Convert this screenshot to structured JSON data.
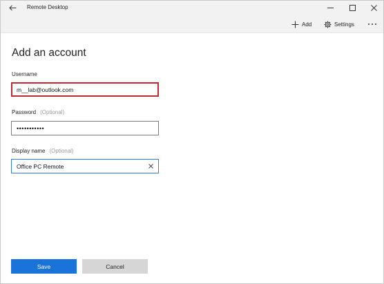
{
  "window": {
    "title": "Remote Desktop"
  },
  "commandbar": {
    "add_label": "Add",
    "settings_label": "Settings"
  },
  "page": {
    "title": "Add an account"
  },
  "form": {
    "username": {
      "label": "Username",
      "value": "m__lab@outlook.com"
    },
    "password": {
      "label": "Password",
      "optional": "(Optional)",
      "value": "•••••••••••"
    },
    "display_name": {
      "label": "Display name",
      "optional": "(Optional)",
      "value": "Office PC Remote"
    }
  },
  "buttons": {
    "save": "Save",
    "cancel": "Cancel"
  },
  "icons": {
    "back": "back-arrow-icon",
    "minimize": "minimize-icon",
    "maximize": "maximize-icon",
    "close": "close-icon",
    "add": "plus-icon",
    "settings": "gear-icon",
    "more": "more-icon",
    "clear": "clear-icon"
  },
  "colors": {
    "accent": "#1a73d9",
    "error_border": "#c4262e",
    "focus_border": "#2b7fd4",
    "chrome": "#f2f2f2"
  }
}
